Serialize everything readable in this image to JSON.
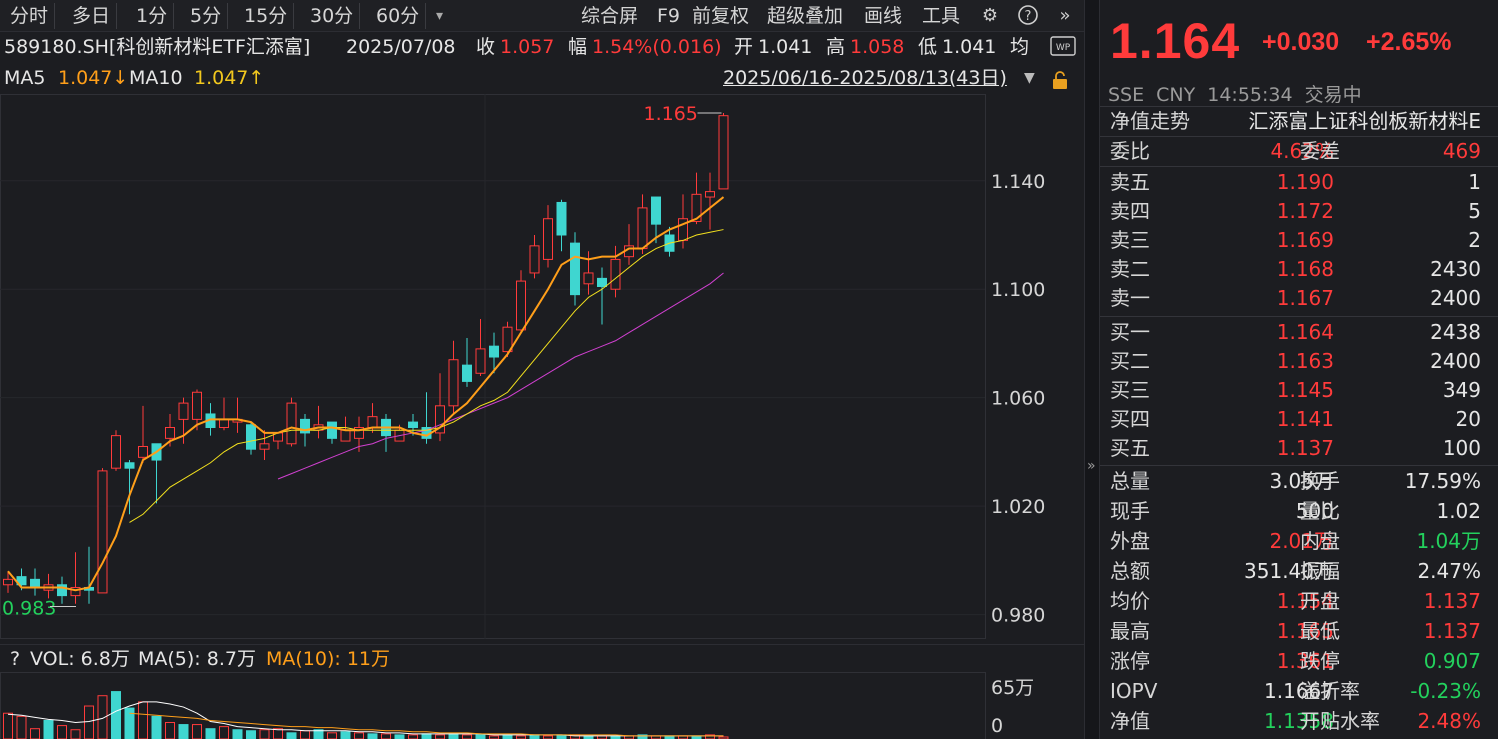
{
  "toolbar": {
    "tabs": [
      "分时",
      "多日",
      "1分",
      "5分",
      "15分",
      "30分",
      "60分"
    ],
    "dropdown": "▾",
    "right_buttons": [
      "综合屏",
      "F9",
      "前复权",
      "超级叠加",
      "画线",
      "工具"
    ]
  },
  "info": {
    "title": "589180.SH[科创新材料ETF汇添富]",
    "date": "2025/07/08",
    "close_label": "收",
    "close_value": "1.057",
    "amp_label": "幅",
    "amp_value": "1.54%(0.016)",
    "open_label": "开",
    "open_value": "1.041",
    "high_label": "高",
    "high_value": "1.058",
    "low_label": "低",
    "low_value": "1.041",
    "avg_label": "均",
    "ma5_label": "MA5",
    "ma5_value": "1.047↓",
    "ma10_label": "MA10",
    "ma10_value": "1.047↑",
    "range": "2025/06/16-2025/08/13(43日)"
  },
  "axis": {
    "y_ticks": [
      "1.140",
      "1.100",
      "1.060",
      "1.020",
      "0.980"
    ],
    "high_marker": "1.165",
    "low_marker": "0.983"
  },
  "volume": {
    "help": "?",
    "vol_label": "VOL: 6.8万",
    "ma5_label": "MA(5): 8.7万",
    "ma10_label": "MA(10): 11万",
    "top_tick": "65万",
    "bottom_tick": "0"
  },
  "quote": {
    "price": "1.164",
    "change": "+0.030",
    "change_pct": "+2.65%",
    "exchange": "SSE",
    "currency": "CNY",
    "time": "14:55:34",
    "status": "交易中",
    "nav_label": "净值走势",
    "fund_name": "汇添富上证科创板新材料E",
    "weibi_label": "委比",
    "weibi_value": "4.62%",
    "weicha_label": "委差",
    "weicha_value": "469"
  },
  "asks": [
    {
      "label": "卖五",
      "price": "1.190",
      "vol": "1"
    },
    {
      "label": "卖四",
      "price": "1.172",
      "vol": "5"
    },
    {
      "label": "卖三",
      "price": "1.169",
      "vol": "2"
    },
    {
      "label": "卖二",
      "price": "1.168",
      "vol": "2430"
    },
    {
      "label": "卖一",
      "price": "1.167",
      "vol": "2400"
    }
  ],
  "bids": [
    {
      "label": "买一",
      "price": "1.164",
      "vol": "2438"
    },
    {
      "label": "买二",
      "price": "1.163",
      "vol": "2400"
    },
    {
      "label": "买三",
      "price": "1.145",
      "vol": "349"
    },
    {
      "label": "买四",
      "price": "1.141",
      "vol": "20"
    },
    {
      "label": "买五",
      "price": "1.137",
      "vol": "100"
    }
  ],
  "stats": [
    {
      "l1": "总量",
      "v1": "3.05万",
      "c1": "white",
      "l2": "换手",
      "v2": "17.59%",
      "c2": "white"
    },
    {
      "l1": "现手",
      "v1": "500",
      "c1": "white",
      "l2": "量比",
      "v2": "1.02",
      "c2": "white"
    },
    {
      "l1": "外盘",
      "v1": "2.01万",
      "c1": "red",
      "l2": "内盘",
      "v2": "1.04万",
      "c2": "green"
    },
    {
      "l1": "总额",
      "v1": "351.40万",
      "c1": "white",
      "l2": "振幅",
      "v2": "2.47%",
      "c2": "white"
    },
    {
      "l1": "均价",
      "v1": "1.154",
      "c1": "red",
      "l2": "开盘",
      "v2": "1.137",
      "c2": "red"
    },
    {
      "l1": "最高",
      "v1": "1.165",
      "c1": "red",
      "l2": "最低",
      "v2": "1.137",
      "c2": "red"
    },
    {
      "l1": "涨停",
      "v1": "1.361",
      "c1": "red",
      "l2": "跌停",
      "v2": "0.907",
      "c2": "green"
    },
    {
      "l1": "IOPV",
      "v1": "1.1667",
      "c1": "white",
      "l2": "溢折率",
      "v2": "-0.23%",
      "c2": "green"
    },
    {
      "l1": "净值",
      "v1": "1.1358",
      "c1": "green",
      "l2": "开贴水率",
      "v2": "2.48%",
      "c2": "red"
    }
  ],
  "colors": {
    "up": "#ff3b3b",
    "down": "#3fd6d0",
    "ma5": "#ff9f1a",
    "ma10": "#f2e01e",
    "ma20": "#d040d0"
  },
  "chart_data": {
    "type": "candlestick",
    "ylim": [
      0.971,
      1.172
    ],
    "candles": [
      [
        0.991,
        0.993,
        0.996,
        0.988
      ],
      [
        0.994,
        0.991,
        0.997,
        0.989
      ],
      [
        0.993,
        0.99,
        0.997,
        0.987
      ],
      [
        0.989,
        0.991,
        0.995,
        0.986
      ],
      [
        0.991,
        0.987,
        0.994,
        0.984
      ],
      [
        0.987,
        0.99,
        1.003,
        0.984
      ],
      [
        0.99,
        0.989,
        1.005,
        0.984
      ],
      [
        0.988,
        1.033,
        1.034,
        0.988
      ],
      [
        1.034,
        1.046,
        1.048,
        1.033
      ],
      [
        1.036,
        1.034,
        1.037,
        1.017
      ],
      [
        1.038,
        1.042,
        1.057,
        1.036
      ],
      [
        1.043,
        1.037,
        1.043,
        1.021
      ],
      [
        1.045,
        1.049,
        1.054,
        1.042
      ],
      [
        1.052,
        1.058,
        1.06,
        1.043
      ],
      [
        1.052,
        1.062,
        1.063,
        1.048
      ],
      [
        1.054,
        1.049,
        1.058,
        1.046
      ],
      [
        1.049,
        1.052,
        1.06,
        1.048
      ],
      [
        1.051,
        1.052,
        1.06,
        1.047
      ],
      [
        1.05,
        1.041,
        1.051,
        1.039
      ],
      [
        1.041,
        1.043,
        1.048,
        1.037
      ],
      [
        1.044,
        1.047,
        1.047,
        1.041
      ],
      [
        1.043,
        1.058,
        1.06,
        1.042
      ],
      [
        1.052,
        1.047,
        1.054,
        1.042
      ],
      [
        1.048,
        1.05,
        1.057,
        1.045
      ],
      [
        1.051,
        1.045,
        1.051,
        1.043
      ],
      [
        1.044,
        1.048,
        1.053,
        1.044
      ],
      [
        1.045,
        1.049,
        1.053,
        1.04
      ],
      [
        1.049,
        1.053,
        1.058,
        1.047
      ],
      [
        1.052,
        1.046,
        1.054,
        1.04
      ],
      [
        1.044,
        1.048,
        1.05,
        1.044
      ],
      [
        1.051,
        1.049,
        1.054,
        1.046
      ],
      [
        1.049,
        1.045,
        1.062,
        1.043
      ],
      [
        1.047,
        1.057,
        1.069,
        1.044
      ],
      [
        1.057,
        1.074,
        1.081,
        1.054
      ],
      [
        1.072,
        1.066,
        1.082,
        1.064
      ],
      [
        1.069,
        1.078,
        1.089,
        1.068
      ],
      [
        1.079,
        1.075,
        1.084,
        1.069
      ],
      [
        1.077,
        1.086,
        1.088,
        1.075
      ],
      [
        1.085,
        1.103,
        1.107,
        1.084
      ],
      [
        1.106,
        1.116,
        1.12,
        1.104
      ],
      [
        1.111,
        1.126,
        1.131,
        1.108
      ],
      [
        1.132,
        1.12,
        1.133,
        1.114
      ],
      [
        1.117,
        1.098,
        1.121,
        1.094
      ],
      [
        1.102,
        1.106,
        1.114,
        1.098
      ],
      [
        1.104,
        1.101,
        1.108,
        1.087
      ],
      [
        1.1,
        1.111,
        1.116,
        1.097
      ],
      [
        1.112,
        1.116,
        1.124,
        1.109
      ],
      [
        1.115,
        1.13,
        1.135,
        1.113
      ],
      [
        1.134,
        1.124,
        1.134,
        1.117
      ],
      [
        1.12,
        1.114,
        1.123,
        1.112
      ],
      [
        1.118,
        1.126,
        1.135,
        1.115
      ],
      [
        1.125,
        1.135,
        1.143,
        1.124
      ],
      [
        1.134,
        1.136,
        1.143,
        1.122
      ],
      [
        1.137,
        1.164,
        1.165,
        1.137
      ]
    ],
    "ma5": [
      0.996,
      0.99,
      0.99,
      0.99,
      0.99,
      0.989,
      0.99,
      0.999,
      1.009,
      1.024,
      1.037,
      1.04,
      1.044,
      1.046,
      1.05,
      1.052,
      1.052,
      1.052,
      1.051,
      1.047,
      1.047,
      1.049,
      1.048,
      1.049,
      1.049,
      1.048,
      1.048,
      1.049,
      1.049,
      1.049,
      1.047,
      1.046,
      1.049,
      1.054,
      1.058,
      1.064,
      1.07,
      1.076,
      1.084,
      1.092,
      1.1,
      1.109,
      1.112,
      1.111,
      1.112,
      1.112,
      1.115,
      1.115,
      1.119,
      1.122,
      1.124,
      1.126,
      1.13,
      1.134
    ],
    "ma10": [
      null,
      null,
      null,
      null,
      null,
      null,
      null,
      null,
      null,
      1.014,
      1.017,
      1.022,
      1.027,
      1.03,
      1.033,
      1.036,
      1.04,
      1.043,
      1.044,
      1.045,
      1.047,
      1.048,
      1.048,
      1.048,
      1.049,
      1.049,
      1.048,
      1.048,
      1.048,
      1.048,
      1.048,
      1.048,
      1.049,
      1.051,
      1.054,
      1.057,
      1.059,
      1.062,
      1.068,
      1.074,
      1.08,
      1.086,
      1.092,
      1.097,
      1.1,
      1.104,
      1.108,
      1.112,
      1.115,
      1.117,
      1.118,
      1.12,
      1.121,
      1.122
    ],
    "ma20": [
      null,
      null,
      null,
      null,
      null,
      null,
      null,
      null,
      null,
      null,
      null,
      null,
      null,
      null,
      null,
      null,
      null,
      null,
      null,
      null,
      1.03,
      1.032,
      1.034,
      1.036,
      1.038,
      1.04,
      1.042,
      1.043,
      1.045,
      1.046,
      1.047,
      1.048,
      1.05,
      1.052,
      1.054,
      1.056,
      1.058,
      1.06,
      1.063,
      1.066,
      1.069,
      1.072,
      1.075,
      1.077,
      1.079,
      1.081,
      1.084,
      1.087,
      1.09,
      1.093,
      1.096,
      1.099,
      1.102,
      1.106
    ],
    "volume": [
      [
        1,
        25
      ],
      [
        1,
        22
      ],
      [
        1,
        10
      ],
      [
        0,
        18
      ],
      [
        1,
        13
      ],
      [
        1,
        9
      ],
      [
        1,
        32
      ],
      [
        1,
        42
      ],
      [
        0,
        46
      ],
      [
        0,
        30
      ],
      [
        1,
        36
      ],
      [
        0,
        22
      ],
      [
        1,
        16
      ],
      [
        0,
        14
      ],
      [
        1,
        14
      ],
      [
        0,
        10
      ],
      [
        1,
        12
      ],
      [
        0,
        9
      ],
      [
        0,
        8
      ],
      [
        1,
        9
      ],
      [
        1,
        10
      ],
      [
        0,
        6
      ],
      [
        1,
        8
      ],
      [
        0,
        9
      ],
      [
        1,
        6
      ],
      [
        0,
        7
      ],
      [
        1,
        6
      ],
      [
        0,
        5
      ],
      [
        1,
        5
      ],
      [
        0,
        4
      ],
      [
        1,
        4
      ],
      [
        0,
        5
      ],
      [
        1,
        4
      ],
      [
        0,
        5
      ],
      [
        1,
        4
      ],
      [
        0,
        4
      ],
      [
        1,
        3
      ],
      [
        0,
        4
      ],
      [
        1,
        3
      ],
      [
        0,
        4
      ],
      [
        1,
        3
      ],
      [
        0,
        4
      ],
      [
        1,
        4
      ],
      [
        0,
        3
      ],
      [
        1,
        3
      ],
      [
        0,
        3
      ],
      [
        1,
        3
      ],
      [
        0,
        4
      ],
      [
        1,
        3
      ],
      [
        0,
        3
      ],
      [
        1,
        3
      ],
      [
        0,
        3
      ],
      [
        1,
        4
      ],
      [
        1,
        2
      ]
    ],
    "vol_max": 65,
    "vol_ma5": [
      24,
      23,
      21,
      19,
      18,
      16,
      17,
      20,
      27,
      32,
      36,
      36,
      34,
      31,
      25,
      17,
      15,
      12,
      11,
      10,
      9,
      9,
      8,
      8,
      8,
      8,
      7,
      7,
      6,
      6,
      5,
      5,
      5,
      5,
      5,
      5,
      4,
      4,
      4,
      4,
      4,
      4,
      3,
      3,
      3,
      3,
      3,
      3,
      3,
      3,
      3,
      3,
      3,
      3
    ],
    "vol_ma10": [
      null,
      null,
      null,
      null,
      null,
      null,
      null,
      null,
      null,
      25,
      24,
      23,
      22,
      21,
      20,
      18,
      17,
      16,
      15,
      14,
      13,
      12,
      12,
      11,
      11,
      10,
      9,
      9,
      8,
      8,
      7,
      7,
      6,
      6,
      6,
      5,
      5,
      5,
      5,
      4,
      4,
      4,
      4,
      4,
      4,
      4,
      3,
      3,
      3,
      3,
      3,
      3,
      3,
      3
    ]
  }
}
